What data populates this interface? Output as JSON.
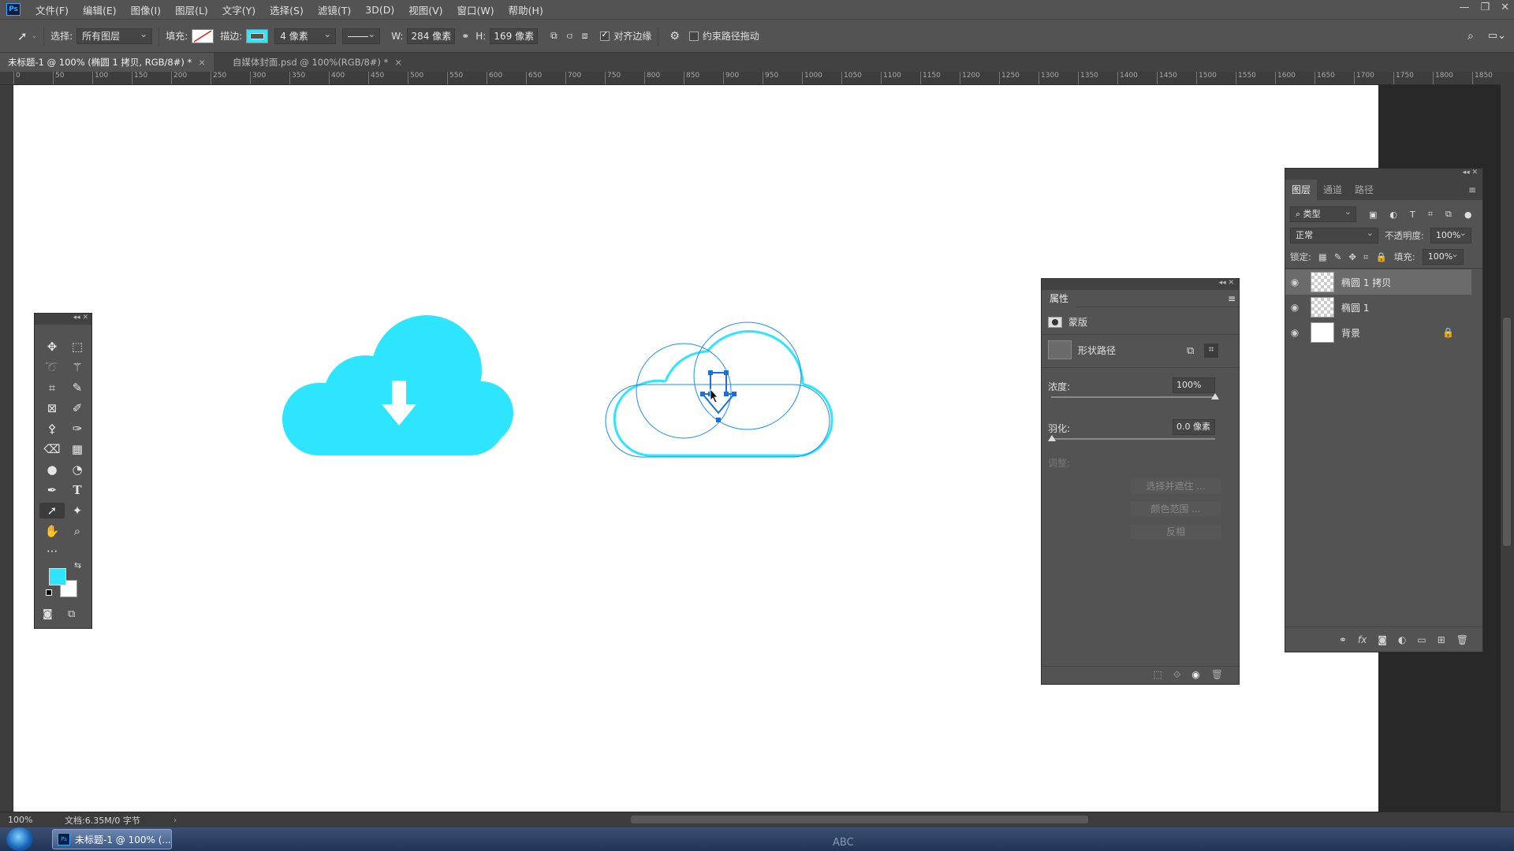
{
  "menubar": {
    "app_icon": "Ps",
    "items": [
      "文件(F)",
      "编辑(E)",
      "图像(I)",
      "图层(L)",
      "文字(Y)",
      "选择(S)",
      "滤镜(T)",
      "3D(D)",
      "视图(V)",
      "窗口(W)",
      "帮助(H)"
    ],
    "window_controls": [
      "—",
      "❐",
      "✕"
    ]
  },
  "options": {
    "select_label": "选择:",
    "select_value": "所有图层",
    "fill_label": "填充:",
    "stroke_label": "描边:",
    "stroke_width": "4 像素",
    "w_label": "W:",
    "w_value": "284 像素",
    "h_label": "H:",
    "h_value": "169 像素",
    "align_edges_label": "对齐边缘",
    "align_edges_checked": true,
    "constrain_path_label": "约束路径拖动",
    "constrain_path_checked": false,
    "accent_color": "#2ee5ff"
  },
  "tabs": [
    {
      "label": "未标题-1 @ 100% (椭圆 1 拷贝, RGB/8#) *",
      "close": "×"
    },
    {
      "label": "自媒体封面.psd @ 100%(RGB/8#) *",
      "close": "×"
    }
  ],
  "ruler_ticks": [
    "0",
    "50",
    "100",
    "150",
    "200",
    "250",
    "300",
    "350",
    "400",
    "450",
    "500",
    "550",
    "600",
    "650",
    "700",
    "750",
    "800",
    "850",
    "900",
    "950",
    "1000",
    "1050",
    "1100",
    "1150",
    "1200",
    "1250",
    "1300",
    "1350",
    "1400",
    "1450",
    "1500",
    "1550",
    "1600",
    "1650",
    "1700",
    "1750",
    "1800",
    "1850"
  ],
  "toolbox": {
    "tools": [
      "move-icon",
      "marquee-icon",
      "lasso-icon",
      "magic-wand-icon",
      "crop-icon",
      "eyedropper-icon",
      "frame-icon",
      "brush-icon",
      "stamp-icon",
      "history-brush-icon",
      "eraser-icon",
      "gradient-icon",
      "blur-icon",
      "dodge-icon",
      "pen-icon",
      "type-icon",
      "path-select-icon",
      "custom-shape-icon",
      "hand-icon",
      "zoom-icon",
      "more-icon"
    ],
    "foreground": "#2ee5ff",
    "background": "#ffffff"
  },
  "properties": {
    "title": "属性",
    "mask_label": "蒙版",
    "shape_path_label": "形状路径",
    "density_label": "浓度:",
    "density_value": "100%",
    "density_fraction": 1.0,
    "feather_label": "羽化:",
    "feather_value": "0.0 像素",
    "refine_label": "调整:",
    "buttons": [
      "选择并遮住 ...",
      "颜色范围 ...",
      "反相"
    ]
  },
  "layers": {
    "tabs": [
      "图层",
      "通道",
      "路径"
    ],
    "filter_kind": "类型",
    "blend_mode": "正常",
    "opacity_label": "不透明度:",
    "opacity_value": "100%",
    "lock_label": "锁定:",
    "fill_label": "填充:",
    "fill_value": "100%",
    "items": [
      {
        "name": "椭圆 1 拷贝",
        "selected": true
      },
      {
        "name": "椭圆 1",
        "selected": false
      },
      {
        "name": "背景",
        "selected": false,
        "locked": true
      }
    ]
  },
  "status": {
    "zoom": "100%",
    "doc_info": "文档:6.35M/0 字节"
  },
  "taskbar": {
    "item_label": "未标题-1 @ 100% (...",
    "ime": "ABC"
  }
}
